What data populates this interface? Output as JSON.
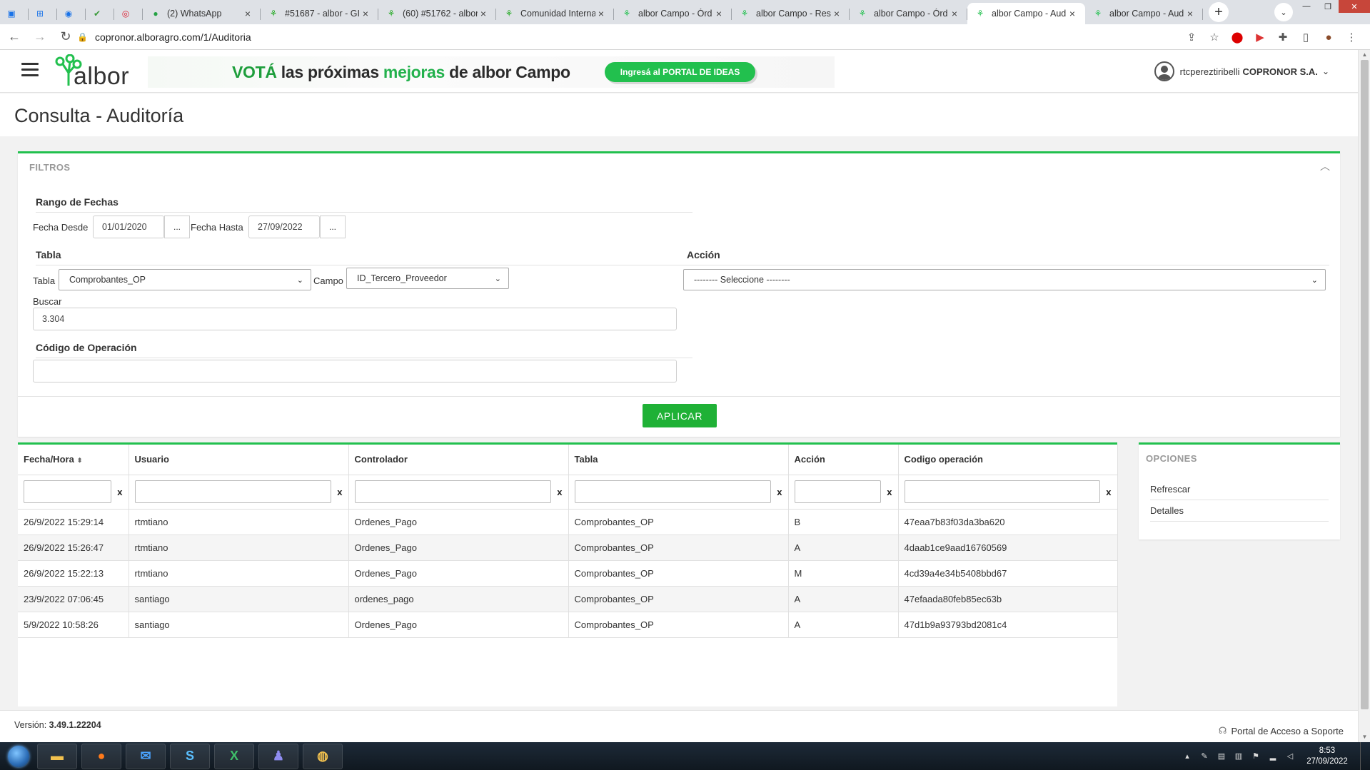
{
  "browser": {
    "tabs": [
      {
        "title": "",
        "icon": "windows-app-icon",
        "pinned": true
      },
      {
        "title": "",
        "icon": "app-icon",
        "pinned": true
      },
      {
        "title": "",
        "icon": "eye-icon",
        "pinned": true
      },
      {
        "title": "",
        "icon": "check-icon",
        "pinned": true
      },
      {
        "title": "",
        "icon": "target-icon",
        "pinned": true
      },
      {
        "title": "(2) WhatsApp",
        "icon": "whatsapp-icon"
      },
      {
        "title": "#51687 - albor - GI",
        "icon": "albor-icon"
      },
      {
        "title": "(60) #51762 - albor",
        "icon": "albor-icon"
      },
      {
        "title": "Comunidad Interna",
        "icon": "albor-icon"
      },
      {
        "title": "albor Campo - Órd",
        "icon": "albor-campo-icon"
      },
      {
        "title": "albor Campo - Res",
        "icon": "albor-campo-icon"
      },
      {
        "title": "albor Campo - Órd",
        "icon": "albor-campo-icon"
      },
      {
        "title": "albor Campo - Aud",
        "icon": "albor-campo-icon",
        "active": true
      },
      {
        "title": "albor Campo - Aud",
        "icon": "albor-campo-icon"
      }
    ],
    "url": "copronor.alboragro.com/1/Auditoria"
  },
  "app": {
    "logo_text": "albor",
    "banner": {
      "part1": "VOTÁ",
      "part2": " las próximas ",
      "part3": "mejoras",
      "part4": " de albor Campo",
      "cta": "Ingresá al PORTAL DE IDEAS"
    },
    "user": {
      "name": "rtcpereztiribelli",
      "company": "COPRONOR S.A."
    },
    "page_title": "Consulta - Auditoría"
  },
  "filters": {
    "header": "FILTROS",
    "date_range": {
      "title": "Rango de Fechas",
      "from_label": "Fecha Desde",
      "from_value": "01/01/2020",
      "to_label": "Fecha Hasta",
      "to_value": "27/09/2022",
      "picker_label": "..."
    },
    "table": {
      "title": "Tabla",
      "table_label": "Tabla",
      "table_value": "Comprobantes_OP",
      "field_label": "Campo",
      "field_value": "ID_Tercero_Proveedor",
      "search_label": "Buscar",
      "search_value": "3.304"
    },
    "action": {
      "title": "Acción",
      "value": "-------- Seleccione --------"
    },
    "operation_code": {
      "title": "Código de Operación",
      "value": ""
    },
    "apply_label": "APLICAR"
  },
  "grid": {
    "columns": [
      "Fecha/Hora",
      "Usuario",
      "Controlador",
      "Tabla",
      "Acción",
      "Codigo operación"
    ],
    "filter_clear": "x",
    "rows": [
      [
        "26/9/2022 15:29:14",
        "rtmtiano",
        "Ordenes_Pago",
        "Comprobantes_OP",
        "B",
        "47eaa7b83f03da3ba620"
      ],
      [
        "26/9/2022 15:26:47",
        "rtmtiano",
        "Ordenes_Pago",
        "Comprobantes_OP",
        "A",
        "4daab1ce9aad16760569"
      ],
      [
        "26/9/2022 15:22:13",
        "rtmtiano",
        "Ordenes_Pago",
        "Comprobantes_OP",
        "M",
        "4cd39a4e34b5408bbd67"
      ],
      [
        "23/9/2022 07:06:45",
        "santiago",
        "ordenes_pago",
        "Comprobantes_OP",
        "A",
        "47efaada80feb85ec63b"
      ],
      [
        "5/9/2022 10:58:26",
        "santiago",
        "Ordenes_Pago",
        "Comprobantes_OP",
        "A",
        "47d1b9a93793bd2081c4"
      ]
    ]
  },
  "options": {
    "header": "OPCIONES",
    "items": [
      "Refrescar",
      "Detalles"
    ]
  },
  "footer": {
    "version_label": "Versión:",
    "version": "3.49.1.22204",
    "support": "Portal de Acceso a Soporte"
  },
  "taskbar": {
    "apps": [
      "S",
      "X"
    ],
    "time": "8:53",
    "date": "27/09/2022"
  },
  "colors": {
    "accent": "#22c04e",
    "button": "#1fb136"
  }
}
